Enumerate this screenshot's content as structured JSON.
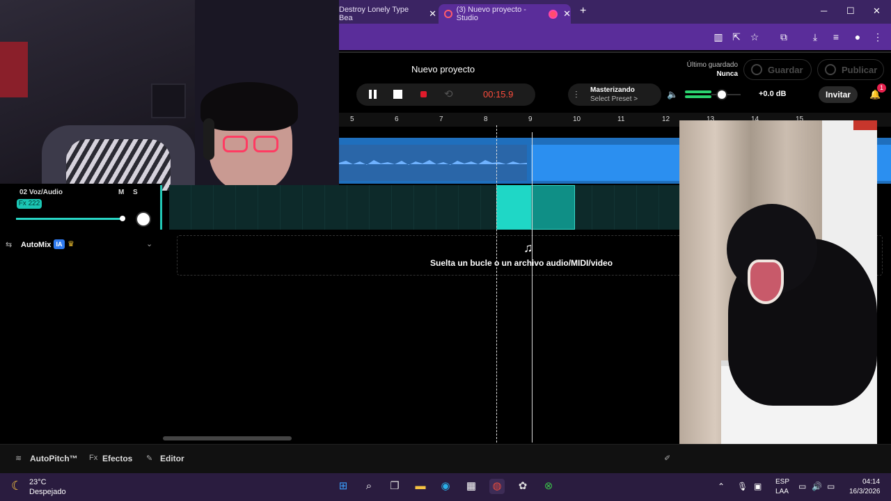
{
  "browser": {
    "tabs": [
      {
        "label": "Destroy Lonely Type Bea",
        "active": false
      },
      {
        "label": "(3) Nuevo proyecto - Studio",
        "active": true
      }
    ],
    "new_tab": "+",
    "close": "✕",
    "window_controls": {
      "minimize": "─",
      "maximize": "☐",
      "close": "✕"
    }
  },
  "header": {
    "project_title": "Nuevo proyecto",
    "last_saved_label": "Último guardado",
    "last_saved_value": "Nunca",
    "save_button": "Guardar",
    "publish_button": "Publicar",
    "invite_button": "Invitar",
    "notification_count": "1"
  },
  "transport": {
    "time": "00:15.9"
  },
  "mastering": {
    "title": "Masterizando",
    "preset": "Select Preset >"
  },
  "volume": {
    "db": "+0.0 dB"
  },
  "ruler": {
    "ticks": [
      "5",
      "6",
      "7",
      "8",
      "9",
      "10",
      "11",
      "12",
      "13",
      "14",
      "15"
    ]
  },
  "track": {
    "name": "02 Voz/Audio",
    "mute": "M",
    "solo": "S",
    "fx": "Fx 222"
  },
  "automix": {
    "label": "AutoMix",
    "badge": "IA"
  },
  "dropzone": {
    "text": "Suelta un bucle o un archivo audio/MIDI/video"
  },
  "bottom_bar": {
    "autopitch": "AutoPitch™",
    "effects": "Efectos",
    "editor": "Editor",
    "fx_prefix": "Fx"
  },
  "taskbar": {
    "temperature": "23°C",
    "weather": "Despejado",
    "lang1": "ESP",
    "lang2": "LAA",
    "time": "04:14",
    "date": "16/3/2026"
  },
  "colors": {
    "accent": "#5a2d9a",
    "track_blue": "#2b8ff0",
    "track_teal": "#1fd7c6",
    "record_red": "#e01b2b",
    "time_red": "#ff4d3d"
  }
}
